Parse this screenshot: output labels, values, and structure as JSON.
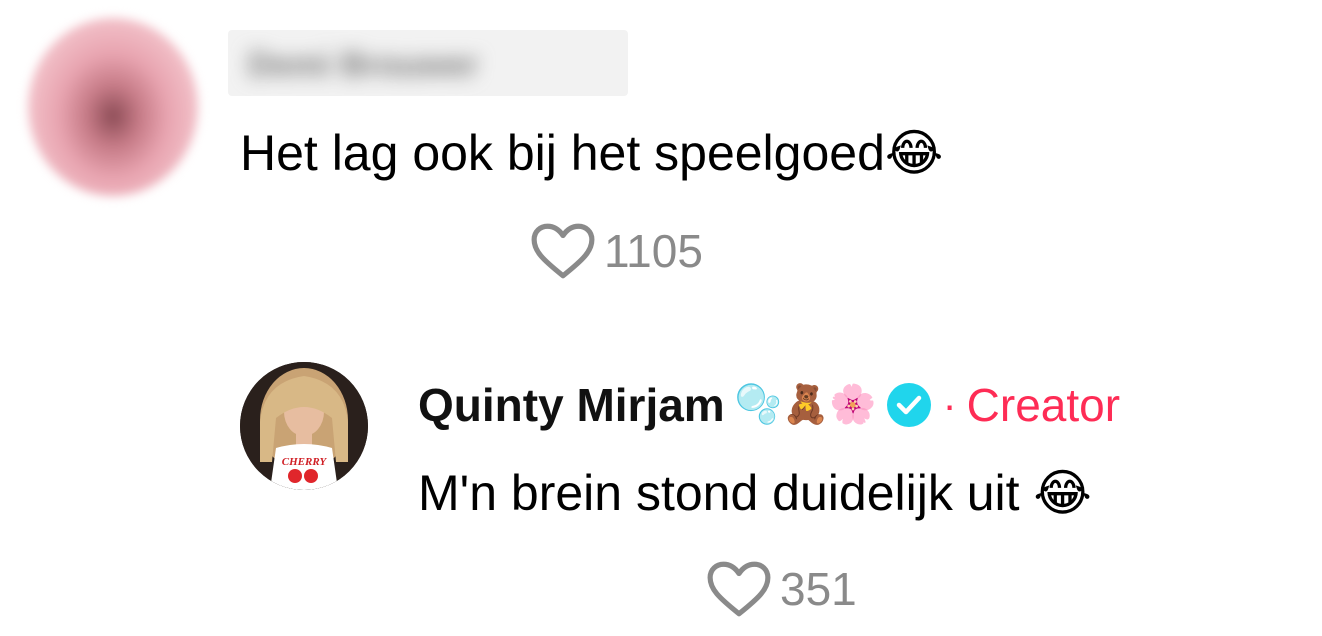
{
  "comments": [
    {
      "username_blurred": "Demi Brouwer",
      "text": "Het lag ook bij het speelgoed😂",
      "likes": "1105"
    }
  ],
  "reply": {
    "username": "Quinty Mirjam",
    "name_emojis": "🫧🧸🌸",
    "separator": "·",
    "role": "Creator",
    "text": "M'n brein stond duidelijk uit 😂",
    "likes": "351",
    "avatar_shirt_text": "CHERRY",
    "colors": {
      "creator": "#fe2c55",
      "verified": "#20d5ec",
      "like": "#8a8a8a"
    }
  },
  "icons": {
    "like": "heart-outline-icon",
    "verified": "verified-badge-icon"
  }
}
